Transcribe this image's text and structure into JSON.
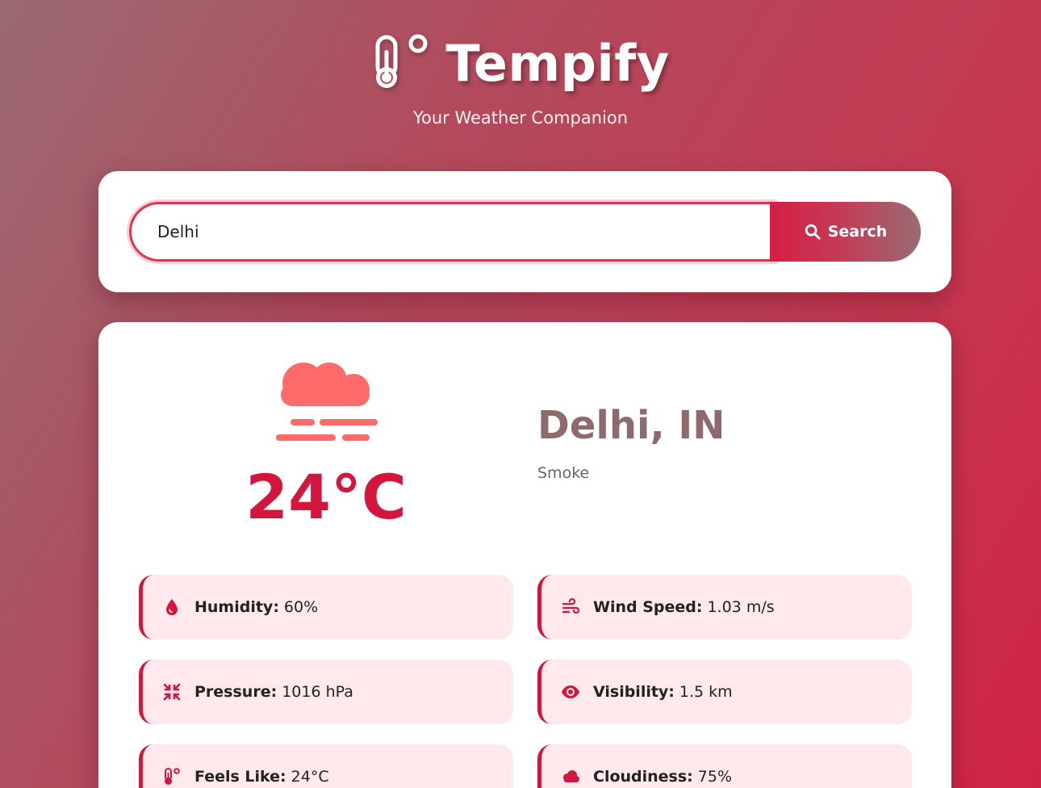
{
  "app": {
    "title": "Tempify",
    "subtitle": "Your Weather Companion"
  },
  "search": {
    "value": "Delhi",
    "button_label": "Search"
  },
  "weather": {
    "temperature": "24°C",
    "location": "Delhi, IN",
    "description": "Smoke",
    "icon": "fog-cloud-icon",
    "details": [
      {
        "label": "Humidity:",
        "value": "60%",
        "icon": "droplet-icon"
      },
      {
        "label": "Wind Speed:",
        "value": "1.03 m/s",
        "icon": "wind-icon"
      },
      {
        "label": "Pressure:",
        "value": "1016 hPa",
        "icon": "compress-icon"
      },
      {
        "label": "Visibility:",
        "value": "1.5 km",
        "icon": "eye-icon"
      },
      {
        "label": "Feels Like:",
        "value": "24°C",
        "icon": "thermometer-icon"
      },
      {
        "label": "Cloudiness:",
        "value": "75%",
        "icon": "cloud-icon"
      }
    ]
  },
  "colors": {
    "accent": "#d3163d",
    "weather_icon": "#ff6b6b",
    "city_text": "#8e6a6e",
    "detail_bg": "#ffe9ec"
  }
}
